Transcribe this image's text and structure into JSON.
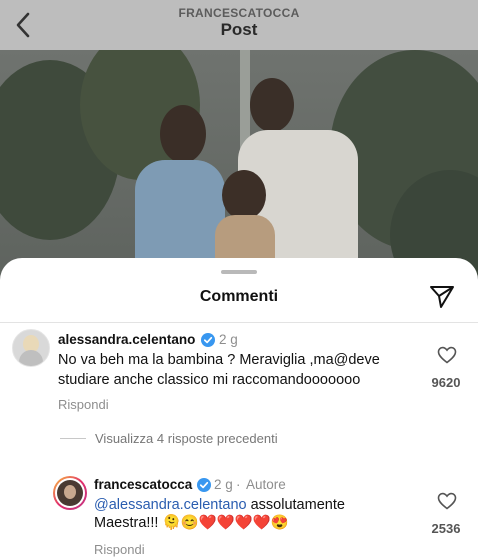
{
  "header": {
    "username": "FRANCESCATOCCA",
    "title": "Post"
  },
  "comments_sheet": {
    "title": "Commenti"
  },
  "comments": [
    {
      "username": "alessandra.celentano",
      "time": "2 g",
      "text_line1": "No va beh ma la bambina ? Meraviglia ,ma@deve",
      "text_line2": "studiare anche classico mi raccomandooooooo",
      "likes": "9620",
      "reply_label": "Rispondi"
    }
  ],
  "view_previous_replies": "Visualizza 4 risposte precedenti",
  "reply": {
    "username": "francescatocca",
    "time": "2 g",
    "author_separator": "·",
    "author_label": "Autore",
    "mention": "@alessandra.celentano",
    "text_after_mention": "assolutamente",
    "text_line2": "Maestra!!!",
    "emojis": "🫠😊❤️❤️❤️❤️😍",
    "likes": "2536",
    "reply_label": "Rispondi"
  },
  "colors": {
    "verified_badge": "#3897f0",
    "mention": "#2a5db0",
    "secondary_text": "#8e8e8e"
  }
}
